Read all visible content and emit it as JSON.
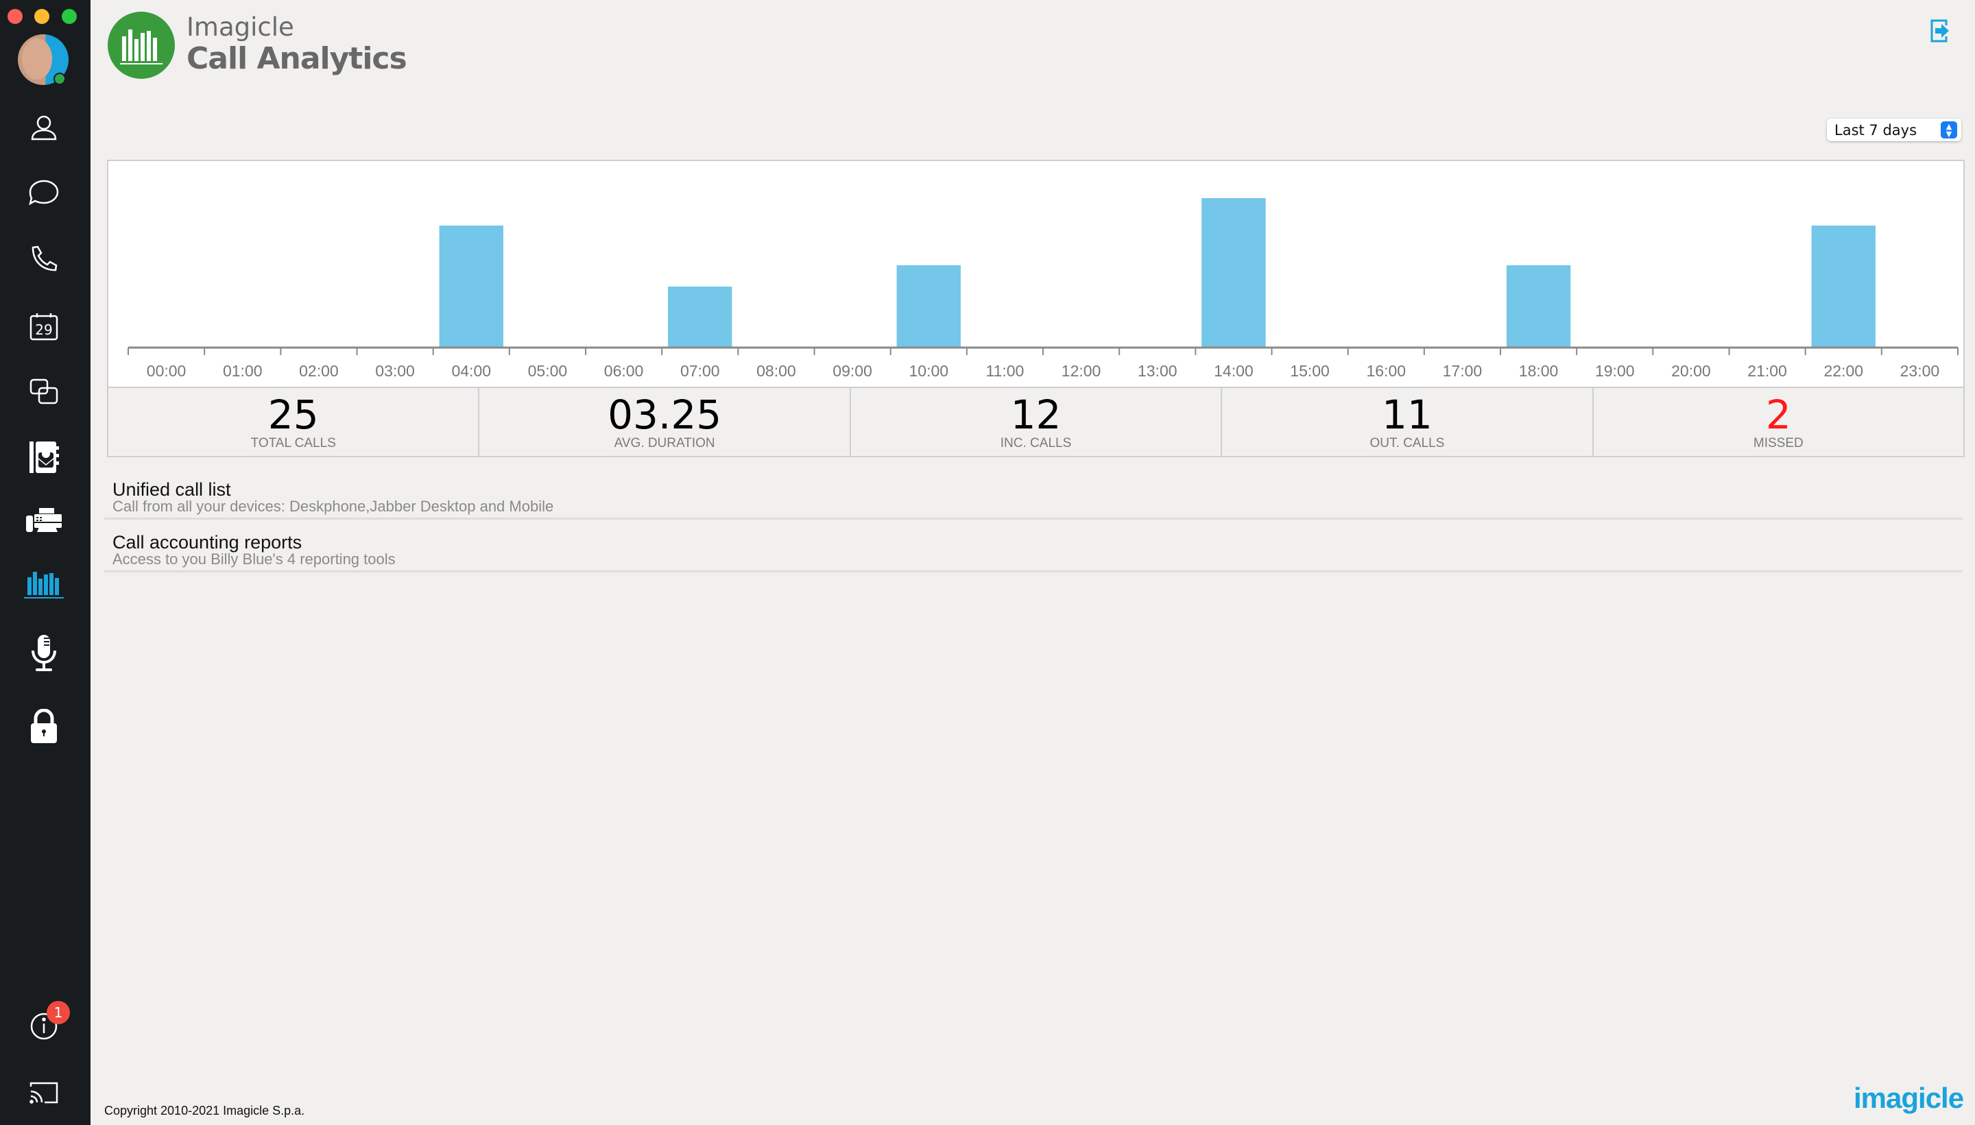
{
  "window": {
    "controls": [
      "close",
      "minimize",
      "zoom"
    ]
  },
  "sidebar": {
    "items": [
      {
        "name": "contacts",
        "icon": "person-icon"
      },
      {
        "name": "chat",
        "icon": "chat-bubble-icon"
      },
      {
        "name": "calls",
        "icon": "phone-icon"
      },
      {
        "name": "calendar",
        "icon": "calendar-icon",
        "label": "29"
      },
      {
        "name": "screen-share",
        "icon": "overlapping-squares-icon"
      },
      {
        "name": "directory",
        "icon": "address-book-icon"
      },
      {
        "name": "fax",
        "icon": "fax-icon"
      },
      {
        "name": "call-analytics",
        "icon": "bar-chart-icon",
        "active": true
      },
      {
        "name": "voice-recording",
        "icon": "microphone-icon"
      },
      {
        "name": "security",
        "icon": "lock-icon"
      },
      {
        "name": "info",
        "icon": "info-icon",
        "badge": "1"
      },
      {
        "name": "cast",
        "icon": "cast-icon"
      }
    ],
    "status_color": "#2fa84a"
  },
  "header": {
    "brand": "Imagicle",
    "title": "Call Analytics",
    "logout_icon": "exit-icon"
  },
  "filter": {
    "selected": "Last 7 days"
  },
  "chart_data": {
    "type": "bar",
    "categories": [
      "00:00",
      "01:00",
      "02:00",
      "03:00",
      "04:00",
      "05:00",
      "06:00",
      "07:00",
      "08:00",
      "09:00",
      "10:00",
      "11:00",
      "12:00",
      "13:00",
      "14:00",
      "15:00",
      "16:00",
      "17:00",
      "18:00",
      "19:00",
      "20:00",
      "21:00",
      "22:00",
      "23:00"
    ],
    "values": [
      0,
      0,
      0,
      0,
      4,
      0,
      0,
      2,
      0,
      0,
      2.7,
      0,
      0,
      0,
      4.9,
      0,
      0,
      0,
      2.7,
      0,
      0,
      0,
      4,
      0
    ],
    "color": "#74c7e8",
    "grid": false
  },
  "stats": [
    {
      "value": "25",
      "label": "TOTAL CALLS"
    },
    {
      "value": "03.25",
      "label": "AVG. DURATION"
    },
    {
      "value": "12",
      "label": "INC. CALLS"
    },
    {
      "value": "11",
      "label": "OUT. CALLS"
    },
    {
      "value": "2",
      "label": "MISSED",
      "color": "#ff1a1a"
    }
  ],
  "links": [
    {
      "title": "Unified call list",
      "subtitle": "Call from all your devices: Deskphone,Jabber Desktop and Mobile"
    },
    {
      "title": "Call accounting reports",
      "subtitle": "Access to you Billy Blue's 4 reporting tools"
    }
  ],
  "footer": {
    "copyright": "Copyright 2010-2021 Imagicle S.p.a.",
    "brand": "imagicle"
  }
}
